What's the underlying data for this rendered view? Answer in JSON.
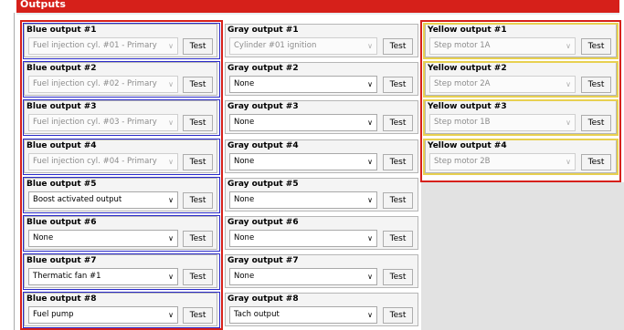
{
  "section_title": "Outputs",
  "test_label": "Test",
  "colors": {
    "header": "#d6201a",
    "blue_frame": "#2929c8",
    "yellow_frame": "#e8d050",
    "red_frame": "#d6201a"
  },
  "blue": [
    {
      "title": "Blue output #1",
      "value": "Fuel injection cyl. #01 - Primary",
      "disabled": true
    },
    {
      "title": "Blue output #2",
      "value": "Fuel injection cyl. #02 - Primary",
      "disabled": true
    },
    {
      "title": "Blue output #3",
      "value": "Fuel injection cyl. #03 - Primary",
      "disabled": true
    },
    {
      "title": "Blue output #4",
      "value": "Fuel injection cyl. #04 - Primary",
      "disabled": true
    },
    {
      "title": "Blue output #5",
      "value": "Boost activated output",
      "disabled": false
    },
    {
      "title": "Blue output #6",
      "value": "None",
      "disabled": false
    },
    {
      "title": "Blue output #7",
      "value": "Thermatic fan #1",
      "disabled": false
    },
    {
      "title": "Blue output #8",
      "value": "Fuel pump",
      "disabled": false
    }
  ],
  "gray": [
    {
      "title": "Gray output #1",
      "value": "Cylinder #01 ignition",
      "disabled": true
    },
    {
      "title": "Gray output #2",
      "value": "None",
      "disabled": false
    },
    {
      "title": "Gray output #3",
      "value": "None",
      "disabled": false
    },
    {
      "title": "Gray output #4",
      "value": "None",
      "disabled": false
    },
    {
      "title": "Gray output #5",
      "value": "None",
      "disabled": false
    },
    {
      "title": "Gray output #6",
      "value": "None",
      "disabled": false
    },
    {
      "title": "Gray output #7",
      "value": "None",
      "disabled": false
    },
    {
      "title": "Gray output #8",
      "value": "Tach output",
      "disabled": false
    }
  ],
  "yellow": [
    {
      "title": "Yellow output #1",
      "value": "Step motor 1A",
      "disabled": true
    },
    {
      "title": "Yellow output #2",
      "value": "Step motor 2A",
      "disabled": true
    },
    {
      "title": "Yellow output #3",
      "value": "Step motor 1B",
      "disabled": true
    },
    {
      "title": "Yellow output #4",
      "value": "Step motor 2B",
      "disabled": true
    }
  ]
}
